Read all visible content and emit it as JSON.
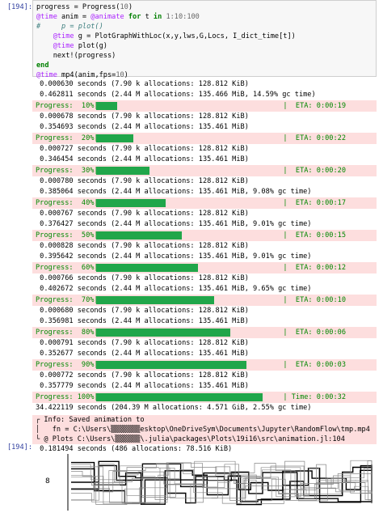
{
  "cell": {
    "prompt_in": "[194]:",
    "prompt_out": "[194]:",
    "code": [
      {
        "parts": [
          [
            "",
            "progress = Progress("
          ],
          [
            "num",
            "10"
          ],
          [
            "",
            ")"
          ]
        ]
      },
      {
        "parts": [
          [
            "mac",
            "@time"
          ],
          [
            "",
            " anim = "
          ],
          [
            "mac",
            "@animate"
          ],
          [
            "kw",
            " for"
          ],
          [
            "",
            " t "
          ],
          [
            "kw",
            "in"
          ],
          [
            "num",
            " 1:10:100"
          ]
        ]
      },
      {
        "parts": [
          [
            "cmt",
            "#     p = plot()"
          ]
        ]
      },
      {
        "parts": [
          [
            "",
            "    "
          ],
          [
            "mac",
            "@time"
          ],
          [
            "",
            " g = PlotGraphWithLoc(x,y,lws,G,Locs, I_dict_time[t])"
          ]
        ]
      },
      {
        "parts": [
          [
            "",
            "    "
          ],
          [
            "mac",
            "@time"
          ],
          [
            "",
            " plot(g)"
          ]
        ]
      },
      {
        "parts": [
          [
            "",
            "    next!(progress)"
          ]
        ]
      },
      {
        "parts": [
          [
            "kw",
            "end"
          ]
        ]
      },
      {
        "parts": [
          [
            "mac",
            "@time"
          ],
          [
            "",
            " mp4(anim,fps="
          ],
          [
            "num",
            "10"
          ],
          [
            "",
            ")"
          ]
        ]
      }
    ]
  },
  "output": [
    {
      "t": "l",
      "text": "0.000630 seconds (7.90 k allocations: 128.812 KiB)"
    },
    {
      "t": "l",
      "text": "0.462811 seconds (2.44 M allocations: 135.466 MiB, 14.59% gc time)"
    },
    {
      "t": "p",
      "label": "Progress:  10%|",
      "eta": "|  ETA: 0:00:19",
      "w": 26
    },
    {
      "t": "l",
      "text": "0.000678 seconds (7.90 k allocations: 128.812 KiB)"
    },
    {
      "t": "l",
      "text": "0.354693 seconds (2.44 M allocations: 135.461 MiB)"
    },
    {
      "t": "p",
      "label": "Progress:  20%|",
      "eta": "|  ETA: 0:00:22",
      "w": 46
    },
    {
      "t": "l",
      "text": "0.000727 seconds (7.90 k allocations: 128.812 KiB)"
    },
    {
      "t": "l",
      "text": "0.346454 seconds (2.44 M allocations: 135.461 MiB)"
    },
    {
      "t": "p",
      "label": "Progress:  30%|",
      "eta": "|  ETA: 0:00:20",
      "w": 66
    },
    {
      "t": "l",
      "text": "0.000780 seconds (7.90 k allocations: 128.812 KiB)"
    },
    {
      "t": "l",
      "text": "0.385064 seconds (2.44 M allocations: 135.461 MiB, 9.08% gc time)"
    },
    {
      "t": "p",
      "label": "Progress:  40%|",
      "eta": "|  ETA: 0:00:17",
      "w": 86
    },
    {
      "t": "l",
      "text": "0.000767 seconds (7.90 k allocations: 128.812 KiB)"
    },
    {
      "t": "l",
      "text": "0.376427 seconds (2.44 M allocations: 135.461 MiB, 9.01% gc time)"
    },
    {
      "t": "p",
      "label": "Progress:  50%|",
      "eta": "|  ETA: 0:00:15",
      "w": 106
    },
    {
      "t": "l",
      "text": "0.000828 seconds (7.90 k allocations: 128.812 KiB)"
    },
    {
      "t": "l",
      "text": "0.395642 seconds (2.44 M allocations: 135.461 MiB, 9.01% gc time)"
    },
    {
      "t": "p",
      "label": "Progress:  60%|",
      "eta": "|  ETA: 0:00:12",
      "w": 126
    },
    {
      "t": "l",
      "text": "0.000766 seconds (7.90 k allocations: 128.812 KiB)"
    },
    {
      "t": "l",
      "text": "0.402672 seconds (2.44 M allocations: 135.461 MiB, 9.65% gc time)"
    },
    {
      "t": "p",
      "label": "Progress:  70%|",
      "eta": "|  ETA: 0:00:10",
      "w": 146
    },
    {
      "t": "l",
      "text": "0.000680 seconds (7.90 k allocations: 128.812 KiB)"
    },
    {
      "t": "l",
      "text": "0.356981 seconds (2.44 M allocations: 135.461 MiB)"
    },
    {
      "t": "p",
      "label": "Progress:  80%|",
      "eta": "|  ETA: 0:00:06",
      "w": 166
    },
    {
      "t": "l",
      "text": "0.000791 seconds (7.90 k allocations: 128.812 KiB)"
    },
    {
      "t": "l",
      "text": "0.352677 seconds (2.44 M allocations: 135.461 MiB)"
    },
    {
      "t": "p",
      "label": "Progress:  90%|",
      "eta": "|  ETA: 0:00:03",
      "w": 186
    },
    {
      "t": "l",
      "text": "0.000772 seconds (7.90 k allocations: 128.812 KiB)"
    },
    {
      "t": "l",
      "text": "0.357779 seconds (2.44 M allocations: 135.461 MiB)"
    },
    {
      "t": "p",
      "label": "Progress: 100%|",
      "eta": "| Time: 0:00:32",
      "w": 206
    },
    {
      "t": "l",
      "text": "34.422119 seconds (204.39 M allocations: 4.571 GiB, 2.55% gc time)",
      "noindent": true
    }
  ],
  "info": [
    "┌ Info: Saved animation to",
    "│   fn = C:\\Users\\▒▒▒▒▒▒▒esktop\\OneDriveSym\\Documents\\Jupyter\\RandomFlow\\tmp.mp4",
    "└ @ Plots C:\\Users\\▒▒▒▒▒▒\\.julia\\packages\\Plots\\19i16\\src\\animation.jl:104"
  ],
  "final_line": "0.181494 seconds (486 allocations: 78.516 KiB)",
  "plot": {
    "ytick": "8"
  }
}
